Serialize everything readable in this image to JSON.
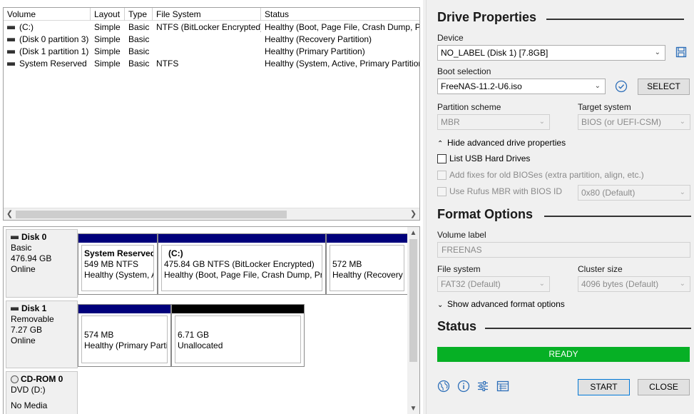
{
  "volumes": {
    "headers": [
      "Volume",
      "Layout",
      "Type",
      "File System",
      "Status"
    ],
    "rows": [
      {
        "volume": "(C:)",
        "layout": "Simple",
        "type": "Basic",
        "fs": "NTFS (BitLocker Encrypted)",
        "status": "Healthy (Boot, Page File, Crash Dump, Pri"
      },
      {
        "volume": "(Disk 0 partition 3)",
        "layout": "Simple",
        "type": "Basic",
        "fs": "",
        "status": "Healthy (Recovery Partition)"
      },
      {
        "volume": "(Disk 1 partition 1)",
        "layout": "Simple",
        "type": "Basic",
        "fs": "",
        "status": "Healthy (Primary Partition)"
      },
      {
        "volume": "System Reserved",
        "layout": "Simple",
        "type": "Basic",
        "fs": "NTFS",
        "status": "Healthy (System, Active, Primary Partition"
      }
    ]
  },
  "disks": {
    "disk0": {
      "name": "Disk 0",
      "type": "Basic",
      "size": "476.94 GB",
      "state": "Online",
      "partitions": [
        {
          "title": "System Reserved",
          "line1": "549 MB NTFS",
          "line2": "Healthy (System, A"
        },
        {
          "title": "(C:)",
          "line1": "475.84 GB NTFS (BitLocker Encrypted)",
          "line2": "Healthy (Boot, Page File, Crash Dump, Pri"
        },
        {
          "title": "",
          "line1": "572 MB",
          "line2": "Healthy (Recovery"
        }
      ]
    },
    "disk1": {
      "name": "Disk 1",
      "type": "Removable",
      "size": "7.27 GB",
      "state": "Online",
      "partitions": [
        {
          "line1": "574 MB",
          "line2": "Healthy (Primary Parti"
        },
        {
          "line1": "6.71 GB",
          "line2": "Unallocated"
        }
      ]
    },
    "cdrom0": {
      "name": "CD-ROM 0",
      "type": "DVD (D:)",
      "state": "No Media"
    }
  },
  "rufus": {
    "drive_properties": "Drive Properties",
    "device_label": "Device",
    "device_value": "NO_LABEL (Disk 1) [7.8GB]",
    "boot_label": "Boot selection",
    "boot_value": "FreeNAS-11.2-U6.iso",
    "select_label": "SELECT",
    "partition_label": "Partition scheme",
    "partition_value": "MBR",
    "target_label": "Target system",
    "target_value": "BIOS (or UEFI-CSM)",
    "hide_advanced": "Hide advanced drive properties",
    "list_usb": "List USB Hard Drives",
    "add_fixes": "Add fixes for old BIOSes (extra partition, align, etc.)",
    "use_rufus_mbr": "Use Rufus MBR with BIOS ID",
    "bios_id_value": "0x80 (Default)",
    "format_options": "Format Options",
    "volume_label_label": "Volume label",
    "volume_label_value": "FREENAS",
    "fs_label": "File system",
    "fs_value": "FAT32 (Default)",
    "cluster_label": "Cluster size",
    "cluster_value": "4096 bytes (Default)",
    "show_advanced": "Show advanced format options",
    "status_title": "Status",
    "progress_text": "READY",
    "progress_color": "#06b025",
    "start_label": "START",
    "close_label": "CLOSE",
    "icons": [
      "globe-icon",
      "info-icon",
      "settings-icon",
      "log-icon"
    ]
  }
}
